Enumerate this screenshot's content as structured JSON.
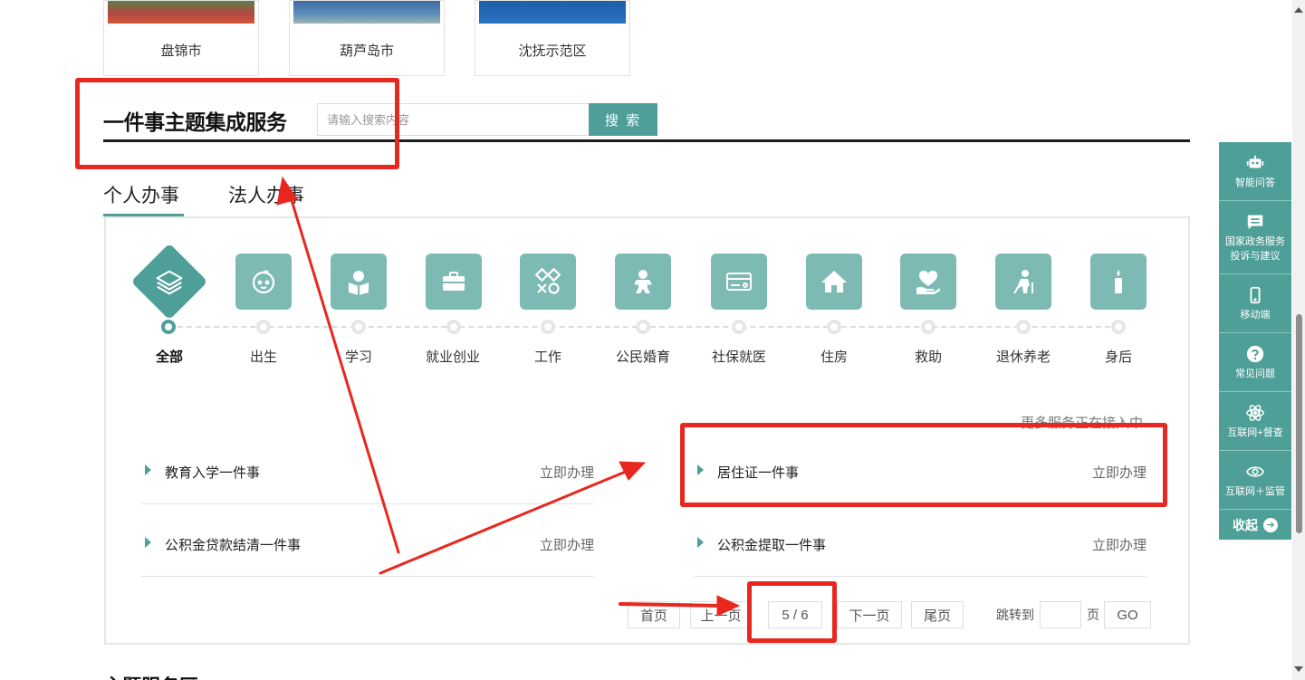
{
  "cities": [
    {
      "name": "盘锦市"
    },
    {
      "name": "葫芦岛市"
    },
    {
      "name": "沈抚示范区"
    }
  ],
  "section": {
    "title": "一件事主题集成服务",
    "search_placeholder": "请输入搜索内容",
    "search_button": "搜 索"
  },
  "tabs": [
    {
      "label": "个人办事",
      "active": true
    },
    {
      "label": "法人办事",
      "active": false
    }
  ],
  "categories": [
    {
      "label": "全部",
      "icon": "layers-icon",
      "active": true
    },
    {
      "label": "出生",
      "icon": "baby-face-icon"
    },
    {
      "label": "学习",
      "icon": "reading-icon"
    },
    {
      "label": "就业创业",
      "icon": "briefcase-icon"
    },
    {
      "label": "工作",
      "icon": "tools-icon"
    },
    {
      "label": "公民婚育",
      "icon": "child-icon"
    },
    {
      "label": "社保就医",
      "icon": "card-icon"
    },
    {
      "label": "住房",
      "icon": "house-icon"
    },
    {
      "label": "救助",
      "icon": "heart-hand-icon"
    },
    {
      "label": "退休养老",
      "icon": "elderly-icon"
    },
    {
      "label": "身后",
      "icon": "candle-icon"
    }
  ],
  "more_note": "更多服务正在接入中",
  "services": [
    {
      "title": "教育入学一件事",
      "action": "立即办理"
    },
    {
      "title": "居住证一件事",
      "action": "立即办理"
    },
    {
      "title": "公积金贷款结清一件事",
      "action": "立即办理"
    },
    {
      "title": "公积金提取一件事",
      "action": "立即办理"
    }
  ],
  "pager": {
    "first": "首页",
    "prev": "上一页",
    "current": "5 / 6",
    "next": "下一页",
    "last": "尾页",
    "jump_label": "跳转到",
    "page_unit": "页",
    "go": "GO"
  },
  "float_bar": [
    {
      "label": "智能问答",
      "icon": "robot-icon"
    },
    {
      "label": "国家政务服务投诉与建议",
      "icon": "message-icon"
    },
    {
      "label": "移动端",
      "icon": "mobile-icon"
    },
    {
      "label": "常见问题",
      "icon": "question-icon"
    },
    {
      "label": "互联网+督查",
      "icon": "atom-icon"
    },
    {
      "label": "互联网＋监管",
      "icon": "eye-icon"
    }
  ],
  "float_collapse": "收起",
  "bottom_heading": "主题服务区",
  "colors": {
    "accent": "#4e9f98",
    "accent_light": "#7dbab4",
    "annotation": "#e8271f"
  }
}
